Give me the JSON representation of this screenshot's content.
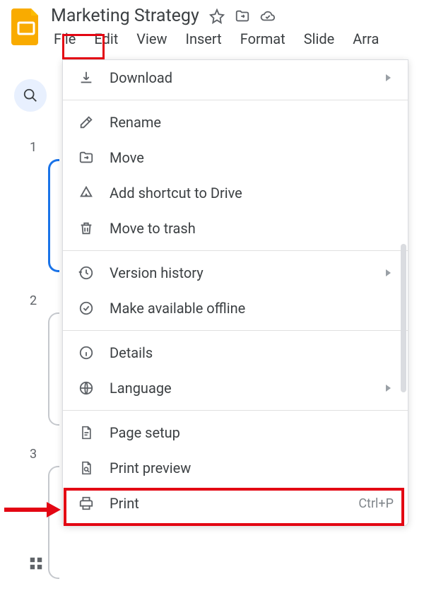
{
  "doc_title": "Marketing Strategy",
  "menubar": {
    "file": "File",
    "edit": "Edit",
    "view": "View",
    "insert": "Insert",
    "format": "Format",
    "slide": "Slide",
    "arrange": "Arra"
  },
  "thumbs": {
    "n1": "1",
    "n2": "2",
    "n3": "3"
  },
  "menu": {
    "download": "Download",
    "rename": "Rename",
    "move": "Move",
    "add_shortcut": "Add shortcut to Drive",
    "move_trash": "Move to trash",
    "version_history": "Version history",
    "make_offline": "Make available offline",
    "details": "Details",
    "language": "Language",
    "page_setup": "Page setup",
    "print_preview": "Print preview",
    "print": "Print",
    "print_shortcut": "Ctrl+P"
  }
}
